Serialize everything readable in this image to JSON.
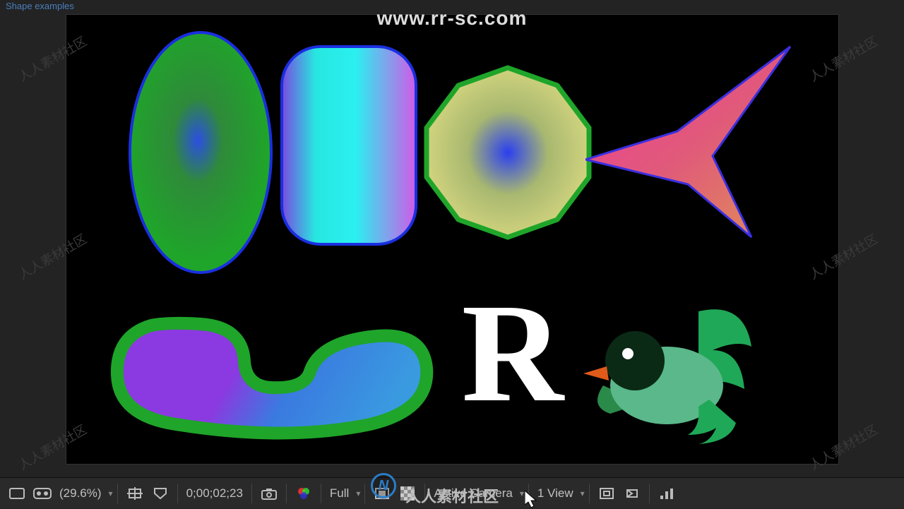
{
  "tabs": {
    "active": "Shape examples"
  },
  "watermark": {
    "url": "www.rr-sc.com",
    "brand": "人人素材社区",
    "small": "人人素材社区"
  },
  "toolbar": {
    "zoom": "(29.6%)",
    "timecode": "0;00;02;23",
    "resolution": "Full",
    "camera": "Active Camera",
    "views": "1 View"
  },
  "shapes": {
    "letter": "R"
  }
}
